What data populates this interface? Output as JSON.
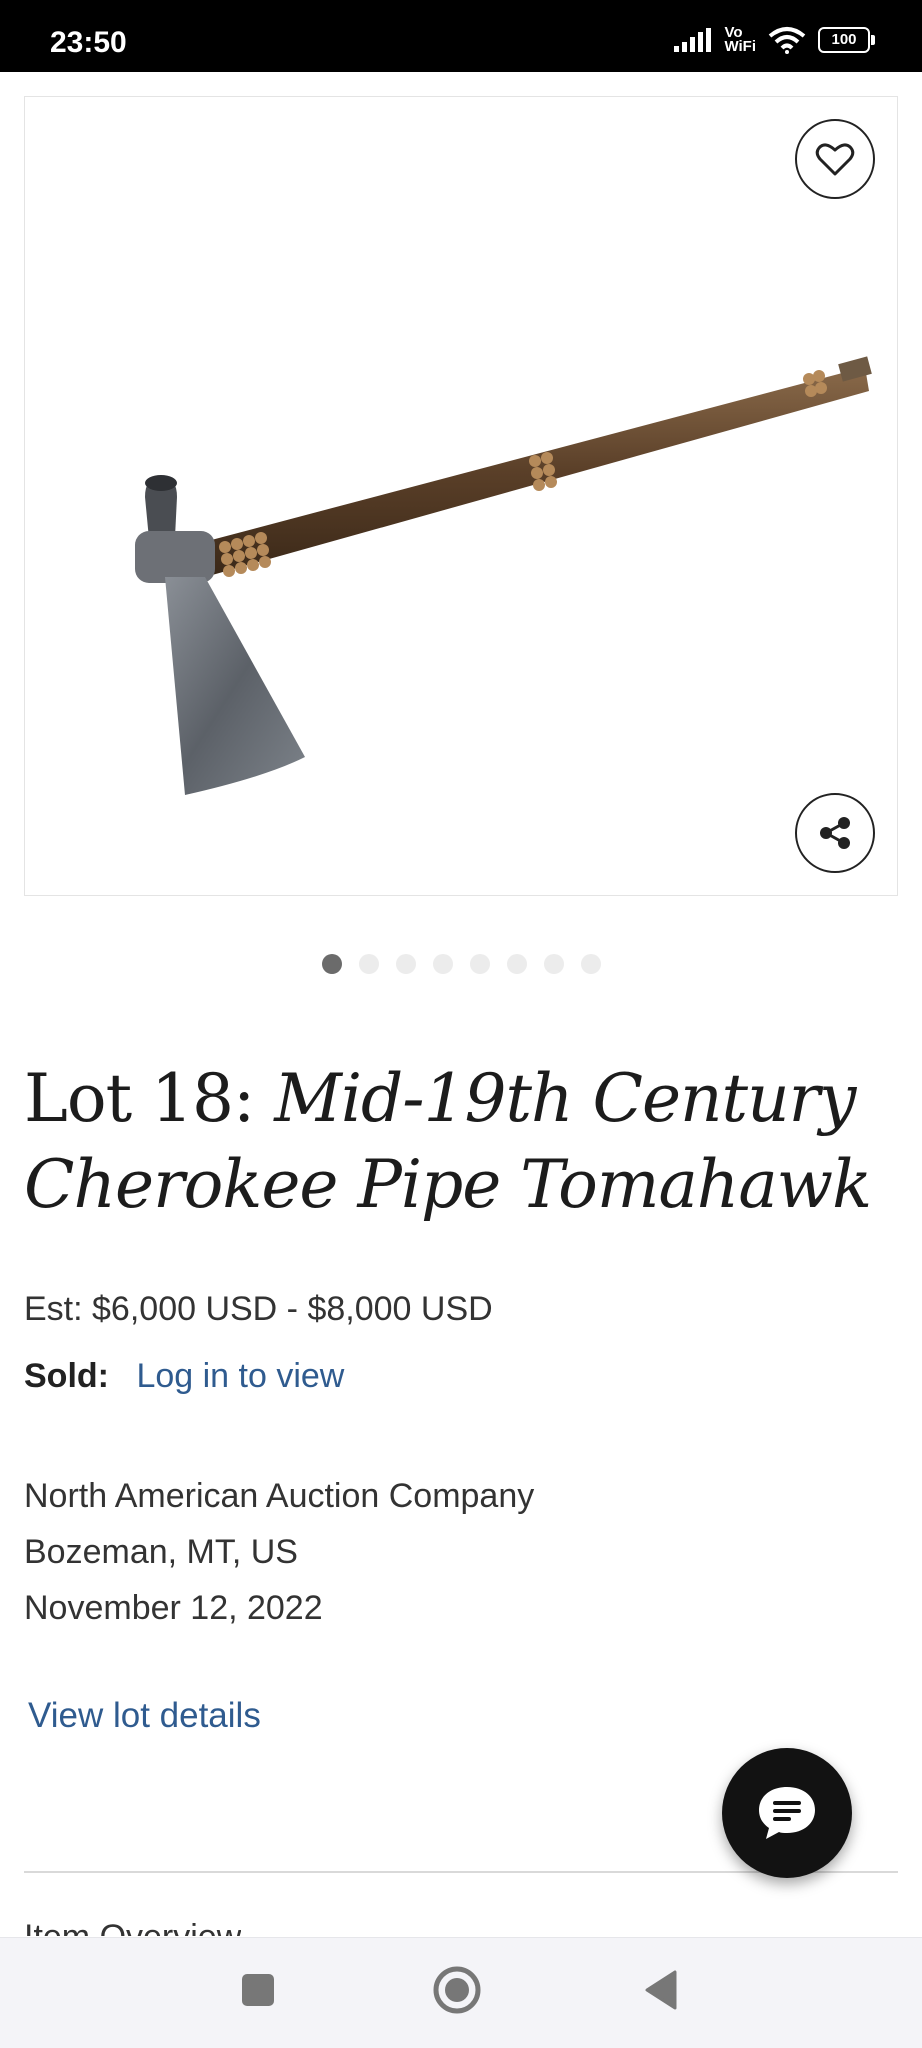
{
  "status_bar": {
    "time": "23:50",
    "network_label_top": "Vo",
    "network_label_bottom": "WiFi",
    "battery": "100"
  },
  "gallery": {
    "image_icon": "pipe-tomahawk-photo",
    "total_images": 8,
    "active_index": 0
  },
  "lot": {
    "prefix": "Lot 18: ",
    "name": "Mid-19th Century Cherokee Pipe Tomahawk",
    "estimate": "Est: $6,000 USD - $8,000 USD",
    "sold_label": "Sold:",
    "sold_link": "Log in to view"
  },
  "seller": {
    "name": "North American Auction Company",
    "location": "Bozeman, MT, US",
    "date": "November 12, 2022"
  },
  "actions": {
    "view_details": "View lot details"
  },
  "peek_text": "Item Overview",
  "colors": {
    "link": "#2f5b8f",
    "status_bar": "#000000",
    "fab": "#121212"
  }
}
